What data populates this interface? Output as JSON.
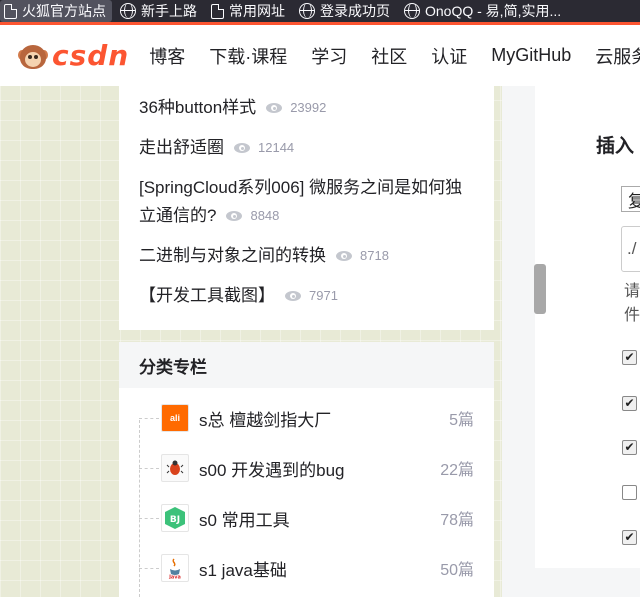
{
  "bookmarks": [
    {
      "label": "火狐官方站点",
      "icon": "page-icon",
      "active": true
    },
    {
      "label": "新手上路",
      "icon": "globe-icon"
    },
    {
      "label": "常用网址",
      "icon": "page-icon"
    },
    {
      "label": "登录成功页",
      "icon": "globe-icon"
    },
    {
      "label": "OnoQQ - 易,简,实用...",
      "icon": "globe-icon"
    }
  ],
  "header": {
    "logo_text": "csdn",
    "nav": [
      "博客",
      "下载·课程",
      "学习",
      "社区",
      "认证",
      "MyGitHub",
      "云服务"
    ]
  },
  "articles": [
    {
      "title": "36种button样式",
      "views": "23992"
    },
    {
      "title": "走出舒适圈",
      "views": "12144"
    },
    {
      "title": "[SpringCloud系列006] 微服务之间是如何独立通信的?",
      "views": "8848"
    },
    {
      "title": "二进制与对象之间的转换",
      "views": "8718"
    },
    {
      "title": "【开发工具截图】",
      "views": "7971"
    }
  ],
  "categories": {
    "title": "分类专栏",
    "items": [
      {
        "name": "s总 檀越剑指大厂",
        "count": "5篇",
        "thumb": "alibaba-logo"
      },
      {
        "name": "s00 开发遇到的bug",
        "count": "22篇",
        "thumb": "bug-icon"
      },
      {
        "name": "s0 常用工具",
        "count": "78篇",
        "thumb": "tool-icon"
      },
      {
        "name": "s1 java基础",
        "count": "50篇",
        "thumb": "java-icon"
      }
    ]
  },
  "right_panel": {
    "title": "插入",
    "box1": "复",
    "box2": "./",
    "hint": "请件",
    "checkboxes": [
      true,
      true,
      true,
      false,
      true
    ]
  }
}
